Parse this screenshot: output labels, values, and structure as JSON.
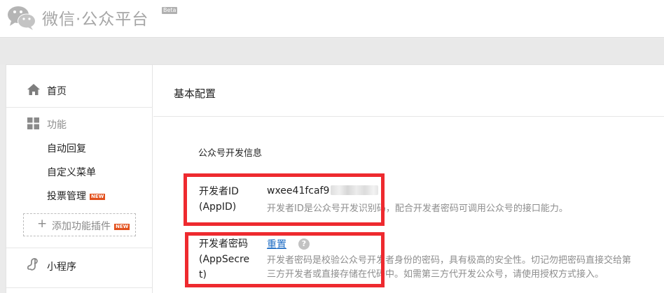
{
  "header": {
    "logo_icon": "wechat-logo-icon",
    "title": "微信·公众平台",
    "beta": "Beta"
  },
  "sidebar": {
    "home": {
      "icon": "home-icon",
      "label": "首页"
    },
    "function": {
      "icon": "grid-icon",
      "label": "功能",
      "items": [
        {
          "label": "自动回复"
        },
        {
          "label": "自定义菜单"
        },
        {
          "label": "投票管理",
          "badge": "NEW"
        }
      ],
      "add_plugin": {
        "label": "添加功能插件",
        "badge": "NEW"
      }
    },
    "mini_program": {
      "icon": "mini-program-icon",
      "label": "小程序"
    }
  },
  "main": {
    "title": "基本配置",
    "section_title": "公众号开发信息",
    "fields": [
      {
        "label_line1": "开发者ID",
        "label_line2": "(AppID)",
        "value": "wxee41fcaf9",
        "description": "开发者ID是公众号开发识别码，配合开发者密码可调用公众号的接口能力。"
      },
      {
        "label_line1": "开发者密码",
        "label_line2": "(AppSecre",
        "label_line3": "t)",
        "action": "重置",
        "help_icon": "question-icon",
        "description_line1": "开发者密码是校验公众号开发者身份的密码，具有极高的安全性。切记勿把密码直接交给第",
        "description_line2": "三方开发者或直接存储在代码中。如需第三方代开发公众号，请使用授权方式接入。"
      }
    ]
  },
  "colors": {
    "highlight": "#ee2a2f",
    "link": "#1e6cc4",
    "new_badge": "#e2501c"
  }
}
